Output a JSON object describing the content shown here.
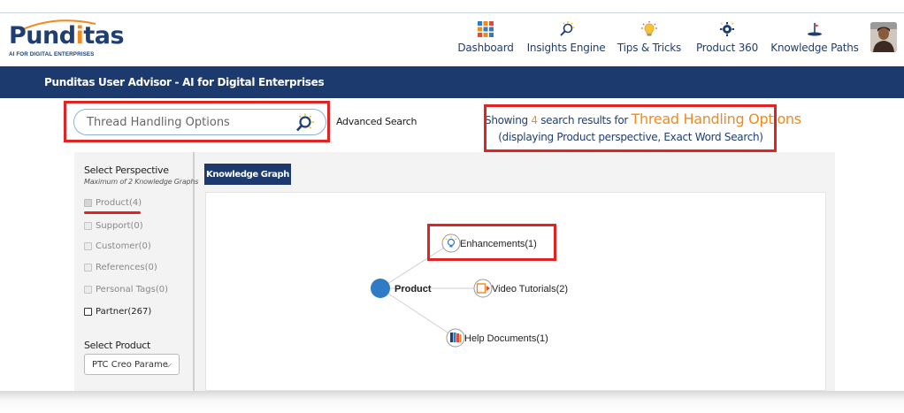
{
  "brand": {
    "name_part1": "Pund",
    "name_highlight": "i",
    "name_part2": "tas",
    "tagline": "AI FOR DIGITAL ENTERPRISES",
    "primary_color": "#1f3f73",
    "accent_color": "#f08a1c"
  },
  "nav": [
    {
      "label": "Dashboard",
      "icon": "dashboard-grid-icon"
    },
    {
      "label": "Insights Engine",
      "icon": "insights-lightbulb-icon"
    },
    {
      "label": "Tips & Tricks",
      "icon": "tips-lightbulb-icon"
    },
    {
      "label": "Product 360",
      "icon": "product-gear-icon"
    },
    {
      "label": "Knowledge Paths",
      "icon": "knowledge-paths-icon"
    }
  ],
  "titlebar": {
    "text": "Punditas User Advisor - AI for Digital Enterprises"
  },
  "search": {
    "value": "Thread Handling Options",
    "advanced_label": "Advanced Search"
  },
  "results": {
    "prefix": "Showing ",
    "count": "4",
    "middle": " search results for ",
    "query": "Thread Handling Options",
    "detail": "(displaying Product perspective, Exact Word Search)"
  },
  "sidebar": {
    "title": "Select Perspective",
    "subtitle": "Maximum of 2 Knowledge Graphs",
    "perspectives": [
      {
        "label": "Product(4)"
      },
      {
        "label": "Support(0)"
      },
      {
        "label": "Customer(0)"
      },
      {
        "label": "References(0)"
      },
      {
        "label": "Personal Tags(0)"
      },
      {
        "label": "Partner(267)"
      }
    ],
    "product_label": "Select Product",
    "product_value": "PTC Creo Parame"
  },
  "graph": {
    "tab_label": "Knowledge Graph",
    "center": "Product",
    "center_color": "#2f7bc6",
    "children": [
      {
        "label": "Enhancements(1)",
        "icon": "enhancements-icon"
      },
      {
        "label": "Video Tutorials(2)",
        "icon": "video-tutorials-icon"
      },
      {
        "label": "Help Documents(1)",
        "icon": "help-documents-icon"
      }
    ]
  },
  "highlight_color": "#e02424"
}
